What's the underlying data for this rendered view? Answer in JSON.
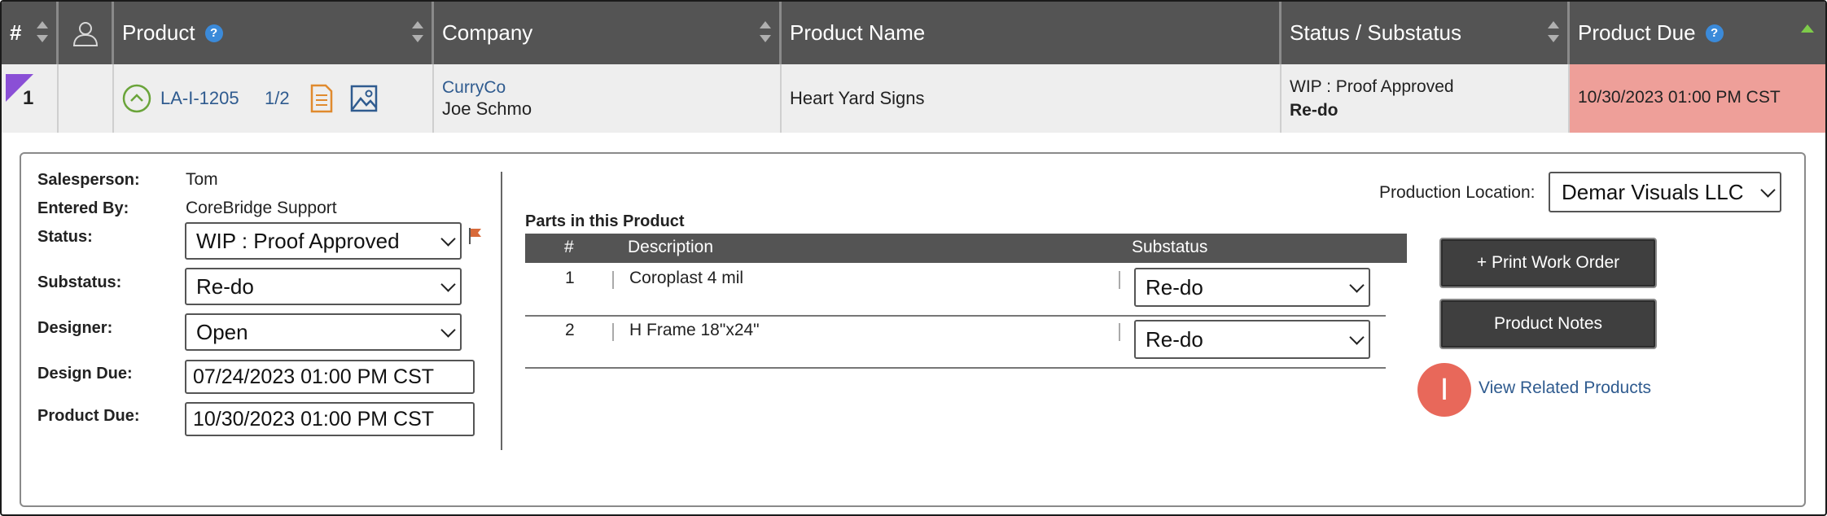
{
  "header": {
    "hash": "#",
    "product": "Product",
    "company": "Company",
    "product_name": "Product Name",
    "status": "Status / Substatus",
    "product_due": "Product Due"
  },
  "row": {
    "number": "1",
    "product_id": "LA-I-1205",
    "count": "1/2",
    "company": "CurryCo",
    "contact": "Joe Schmo",
    "product_name": "Heart Yard Signs",
    "status": "WIP : Proof Approved",
    "substatus": "Re-do",
    "due": "10/30/2023 01:00 PM CST"
  },
  "details": {
    "salesperson_label": "Salesperson:",
    "salesperson": "Tom",
    "entered_by_label": "Entered By:",
    "entered_by": "CoreBridge Support",
    "status_label": "Status:",
    "status_value": "WIP : Proof Approved",
    "substatus_label": "Substatus:",
    "substatus_value": "Re-do",
    "designer_label": "Designer:",
    "designer_value": "Open",
    "design_due_label": "Design Due:",
    "design_due_value": "07/24/2023 01:00 PM CST",
    "product_due_label": "Product Due:",
    "product_due_value": "10/30/2023 01:00 PM CST"
  },
  "parts": {
    "title": "Parts in this Product",
    "columns": [
      "#",
      "Description",
      "Substatus"
    ],
    "rows": [
      {
        "num": "1",
        "description": "Coroplast 4 mil",
        "substatus": "Re-do"
      },
      {
        "num": "2",
        "description": "H Frame 18\"x24\"",
        "substatus": "Re-do"
      }
    ]
  },
  "production": {
    "label": "Production Location:",
    "value": "Demar Visuals LLC"
  },
  "actions": {
    "print_work_order": "+ Print Work Order",
    "product_notes": "Product Notes",
    "view_related": "View Related Products",
    "badge_letter": "I"
  },
  "colors": {
    "header_bg": "#545454",
    "due_highlight": "#ee9f99",
    "flag": "#d86a3a",
    "link": "#2f5b8f",
    "badge": "#e8685a",
    "corner_marker": "#8a4fd6"
  },
  "icons": [
    "sort-icon",
    "user-icon",
    "help-icon",
    "chevron-up-circle-icon",
    "document-icon",
    "image-icon",
    "flag-icon",
    "chevron-down-icon"
  ]
}
